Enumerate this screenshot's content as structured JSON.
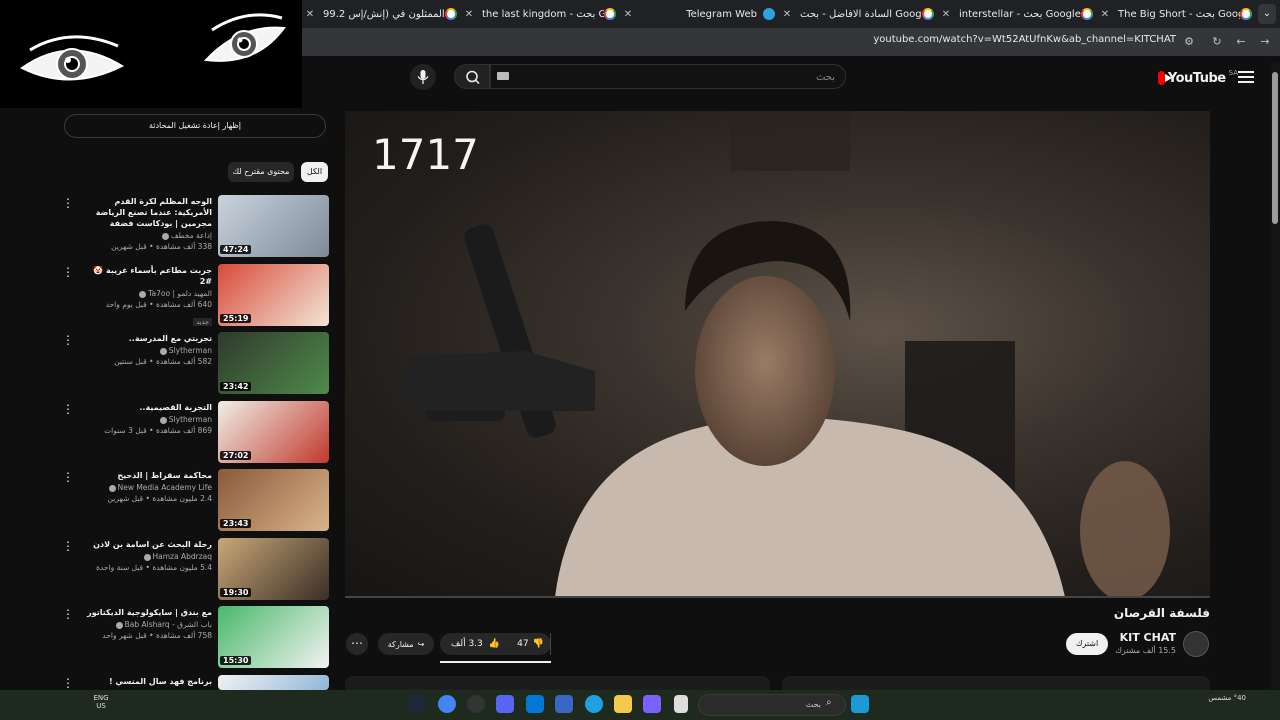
{
  "browser": {
    "tabs": [
      {
        "title": "The Big Short - بحث Google",
        "icon": "google-icon"
      },
      {
        "title": "interstellar - بحث Google",
        "icon": "google-icon"
      },
      {
        "title": "السادة الافاضل - بحث Google",
        "icon": "google-icon"
      },
      {
        "title": "Telegram Web",
        "icon": "telegram-icon"
      },
      {
        "title": "the last kingdom - بحث Google",
        "icon": "google-icon"
      },
      {
        "title": "الممثلون في (إنش/إس 99.2",
        "icon": "google-icon"
      }
    ],
    "close_glyph": "✕",
    "menu_glyph": "⌄",
    "url": "youtube.com/watch?v=Wt52AtUfnKw&ab_channel=KITCHAT"
  },
  "youtube": {
    "logo_text": "YouTube",
    "logo_country": "SA",
    "search_placeholder": "بحث"
  },
  "player": {
    "overlay_text": "1717"
  },
  "video": {
    "title": "فلسفة القرصان",
    "channel": "KIT CHAT",
    "subscribers": "15.5 ألف مشترك",
    "subscribe_label": "اشترك",
    "likes": "3.3 ألف",
    "dislikes": "47",
    "share_label": "مشاركة",
    "more_glyph": "⋯"
  },
  "sidebar": {
    "chat_toggle": "إظهار إعادة تشغيل المحادثة",
    "chips": [
      "الكل",
      "محتوى مقترح لك"
    ],
    "recommendations": [
      {
        "title": "الوجه المظلم لكرة القدم الأمريكية: عندما تصنع الرياضة مجرمين | بودكاست فضفة",
        "channel": "إذاعة مخطف",
        "meta": "338 ألف مشاهدة • قبل شهرين",
        "duration": "47:24",
        "badge": "",
        "thumb_colors": [
          "#c9d3dd",
          "#7d8a99"
        ]
      },
      {
        "title": "جربت مطاعم بأسماء غريبة 🤡 #2",
        "channel": "المهيد دلمو | Ta7oo",
        "meta": "640 ألف مشاهدة • قبل يوم واحد",
        "duration": "25:19",
        "badge": "جديد",
        "thumb_colors": [
          "#d94a3a",
          "#f2e6d8"
        ]
      },
      {
        "title": "تجربتي مع المدرسة..",
        "channel": "Slytherman",
        "meta": "582 ألف مشاهدة • قبل سنتين",
        "duration": "23:42",
        "badge": "",
        "thumb_colors": [
          "#2f3a2c",
          "#4f8a4a"
        ]
      },
      {
        "title": "التجربة القصيمية..",
        "channel": "Slytherman",
        "meta": "869 ألف مشاهدة • قبل 3 سنوات",
        "duration": "27:02",
        "badge": "",
        "thumb_colors": [
          "#f0efe8",
          "#c0392b"
        ]
      },
      {
        "title": "محاكمة سقراط | الدحيح",
        "channel": "New Media Academy Life",
        "meta": "2.4 مليون مشاهدة • قبل شهرين",
        "duration": "23:43",
        "badge": "",
        "thumb_colors": [
          "#8a5a3a",
          "#d9b48a"
        ]
      },
      {
        "title": "رحلة البحث عن اسامة بن لادن",
        "channel": "Hamza Abdrzaq",
        "meta": "5.4 مليون مشاهدة • قبل سنة واحدة",
        "duration": "19:30",
        "badge": "",
        "thumb_colors": [
          "#c8a878",
          "#3a2e26"
        ]
      },
      {
        "title": "مع بندق | سايكولوجية الديكتاتور",
        "channel": "باب الشرق - Bab Alsharq",
        "meta": "758 ألف مشاهدة • قبل شهر واحد",
        "duration": "15:30",
        "badge": "",
        "thumb_colors": [
          "#49b86a",
          "#f2f2f2"
        ]
      },
      {
        "title": "برنامج فهد سال المنسي !",
        "channel": "",
        "meta": "",
        "duration": "",
        "badge": "",
        "thumb_colors": [
          "#f2f2f2",
          "#8fb7d8"
        ]
      }
    ],
    "more_glyph": "⋮"
  },
  "taskbar": {
    "search_placeholder": "بحث",
    "language": "ENG\nUS",
    "clock": "",
    "weather": "°40 مشمس"
  }
}
